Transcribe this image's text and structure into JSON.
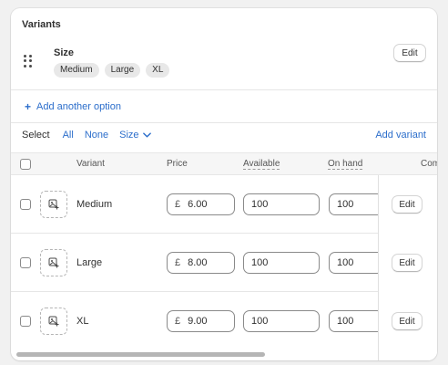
{
  "card": {
    "title": "Variants"
  },
  "option": {
    "name": "Size",
    "values": [
      "Medium",
      "Large",
      "XL"
    ],
    "edit_label": "Edit"
  },
  "add_option": {
    "label": "Add another option",
    "icon": "plus-icon"
  },
  "select_bar": {
    "label": "Select",
    "all": "All",
    "none": "None",
    "size_filter": "Size",
    "add_variant": "Add variant"
  },
  "table": {
    "headers": {
      "variant": "Variant",
      "price": "Price",
      "available": "Available",
      "on_hand": "On hand",
      "committed": "Com"
    },
    "currency": "£",
    "rows": [
      {
        "name": "Medium",
        "price": "6.00",
        "available": "100",
        "on_hand": "100",
        "edit_label": "Edit"
      },
      {
        "name": "Large",
        "price": "8.00",
        "available": "100",
        "on_hand": "100",
        "edit_label": "Edit"
      },
      {
        "name": "XL",
        "price": "9.00",
        "available": "100",
        "on_hand": "100",
        "edit_label": "Edit"
      }
    ]
  },
  "colors": {
    "link": "#2c6ecb",
    "background": "#f1f1f1",
    "card": "#ffffff"
  }
}
